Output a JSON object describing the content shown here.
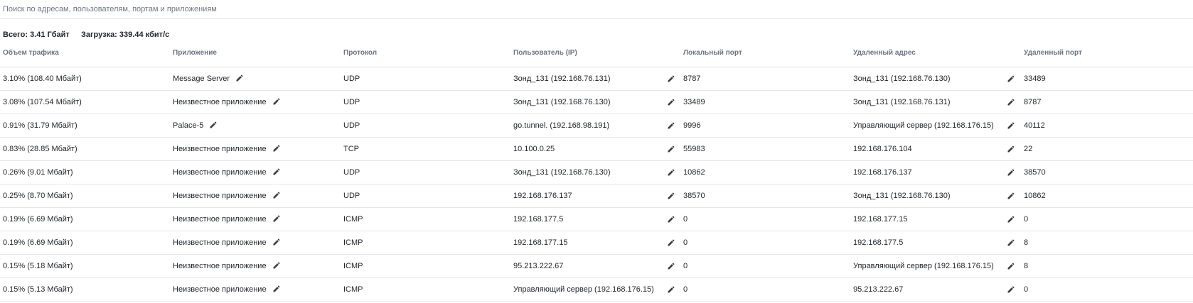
{
  "search": {
    "placeholder": "Поиск по адресам, пользователям, портам и приложениям",
    "value": ""
  },
  "summary": {
    "total_label": "Всего:",
    "total_value": "3.41 Гбайт",
    "load_label": "Загрузка:",
    "load_value": "339.44 кбит/с"
  },
  "columns": [
    "Объем трафика",
    "Приложение",
    "Протокол",
    "Пользователь (IP)",
    "Локальный порт",
    "Удаленный адрес",
    "Удаленный порт"
  ],
  "icons": {
    "edit": "pencil-icon"
  },
  "colors": {
    "text": "#1f2328",
    "header_text": "#6b7380",
    "divider": "#e4e7eb",
    "icon": "#3a3f45"
  },
  "rows": [
    {
      "traffic": "3.10% (108.40 Мбайт)",
      "application": "Message Server",
      "protocol": "UDP",
      "user": "Зонд_131 (192.168.76.131)",
      "local_port": "8787",
      "remote_address": "Зонд_131 (192.168.76.130)",
      "remote_port": "33489"
    },
    {
      "traffic": "3.08% (107.54 Мбайт)",
      "application": "Неизвестное приложение",
      "protocol": "UDP",
      "user": "Зонд_131 (192.168.76.130)",
      "local_port": "33489",
      "remote_address": "Зонд_131 (192.168.76.131)",
      "remote_port": "8787"
    },
    {
      "traffic": "0.91% (31.79 Мбайт)",
      "application": "Palace-5",
      "protocol": "UDP",
      "user": "go.tunnel. (192.168.98.191)",
      "local_port": "9996",
      "remote_address": "Управляющий сервер (192.168.176.15)",
      "remote_port": "40112"
    },
    {
      "traffic": "0.83% (28.85 Мбайт)",
      "application": "Неизвестное приложение",
      "protocol": "TCP",
      "user": "10.100.0.25",
      "local_port": "55983",
      "remote_address": "192.168.176.104",
      "remote_port": "22"
    },
    {
      "traffic": "0.26% (9.01 Мбайт)",
      "application": "Неизвестное приложение",
      "protocol": "UDP",
      "user": "Зонд_131 (192.168.76.130)",
      "local_port": "10862",
      "remote_address": "192.168.176.137",
      "remote_port": "38570"
    },
    {
      "traffic": "0.25% (8.70 Мбайт)",
      "application": "Неизвестное приложение",
      "protocol": "UDP",
      "user": "192.168.176.137",
      "local_port": "38570",
      "remote_address": "Зонд_131 (192.168.76.130)",
      "remote_port": "10862"
    },
    {
      "traffic": "0.19% (6.69 Мбайт)",
      "application": "Неизвестное приложение",
      "protocol": "ICMP",
      "user": "192.168.177.5",
      "local_port": "0",
      "remote_address": "192.168.177.15",
      "remote_port": "0"
    },
    {
      "traffic": "0.19% (6.69 Мбайт)",
      "application": "Неизвестное приложение",
      "protocol": "ICMP",
      "user": "192.168.177.15",
      "local_port": "0",
      "remote_address": "192.168.177.5",
      "remote_port": "8"
    },
    {
      "traffic": "0.15% (5.18 Мбайт)",
      "application": "Неизвестное приложение",
      "protocol": "ICMP",
      "user": "95.213.222.67",
      "local_port": "0",
      "remote_address": "Управляющий сервер (192.168.176.15)",
      "remote_port": "8"
    },
    {
      "traffic": "0.15% (5.13 Мбайт)",
      "application": "Неизвестное приложение",
      "protocol": "ICMP",
      "user": "Управляющий сервер (192.168.176.15)",
      "local_port": "0",
      "remote_address": "95.213.222.67",
      "remote_port": "0"
    }
  ]
}
